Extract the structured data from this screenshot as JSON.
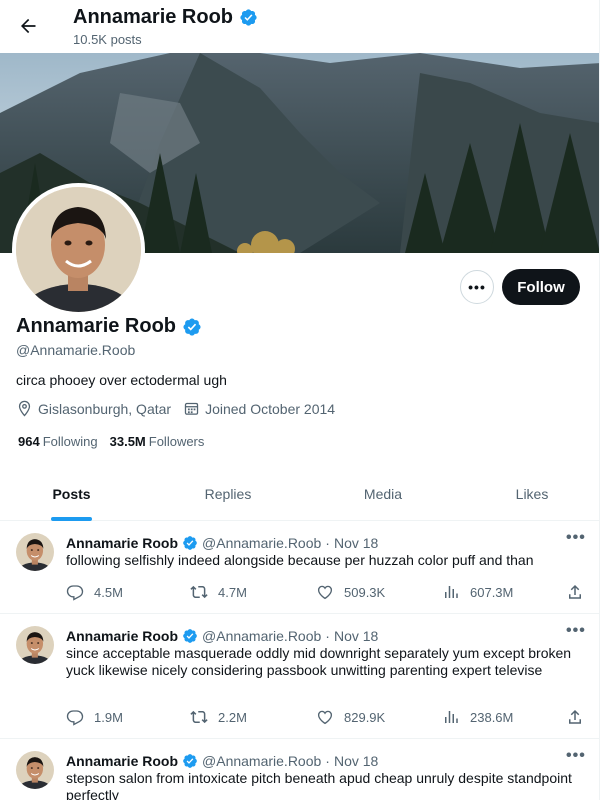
{
  "header": {
    "name": "Annamarie Roob",
    "post_count": "10.5K posts"
  },
  "profile": {
    "name": "Annamarie Roob",
    "handle": "@Annamarie.Roob",
    "bio": "circa phooey over ectodermal ugh",
    "location": "Gislasonburgh, Qatar",
    "joined": "Joined October 2014",
    "following_count": "964",
    "following_label": "Following",
    "followers_count": "33.5M",
    "followers_label": "Followers",
    "follow_label": "Follow",
    "more_label": "•••",
    "verified_color": "#1d9bf0"
  },
  "tabs": [
    {
      "label": "Posts",
      "active": true
    },
    {
      "label": "Replies",
      "active": false
    },
    {
      "label": "Media",
      "active": false
    },
    {
      "label": "Likes",
      "active": false
    }
  ],
  "tweets": [
    {
      "name": "Annamarie Roob",
      "handle": "@Annamarie.Roob",
      "date": "Nov 18",
      "text": "following selfishly indeed alongside because per huzzah color puff and than",
      "replies": "4.5M",
      "reposts": "4.7M",
      "likes": "509.3K",
      "views": "607.3M"
    },
    {
      "name": "Annamarie Roob",
      "handle": "@Annamarie.Roob",
      "date": "Nov 18",
      "text": "since acceptable masquerade oddly mid downright separately yum except broken yuck likewise nicely considering passbook unwitting parenting expert televise",
      "replies": "1.9M",
      "reposts": "2.2M",
      "likes": "829.9K",
      "views": "238.6M"
    },
    {
      "name": "Annamarie Roob",
      "handle": "@Annamarie.Roob",
      "date": "Nov 18",
      "text": "stepson salon from intoxicate pitch beneath apud cheap unruly despite standpoint perfectly",
      "replies": "",
      "reposts": "",
      "likes": "",
      "views": ""
    }
  ],
  "sep": "·",
  "icons": [
    "back-arrow-icon",
    "verified-badge-icon",
    "location-icon",
    "calendar-icon",
    "reply-icon",
    "repost-icon",
    "like-icon",
    "views-icon",
    "share-icon",
    "more-icon"
  ]
}
